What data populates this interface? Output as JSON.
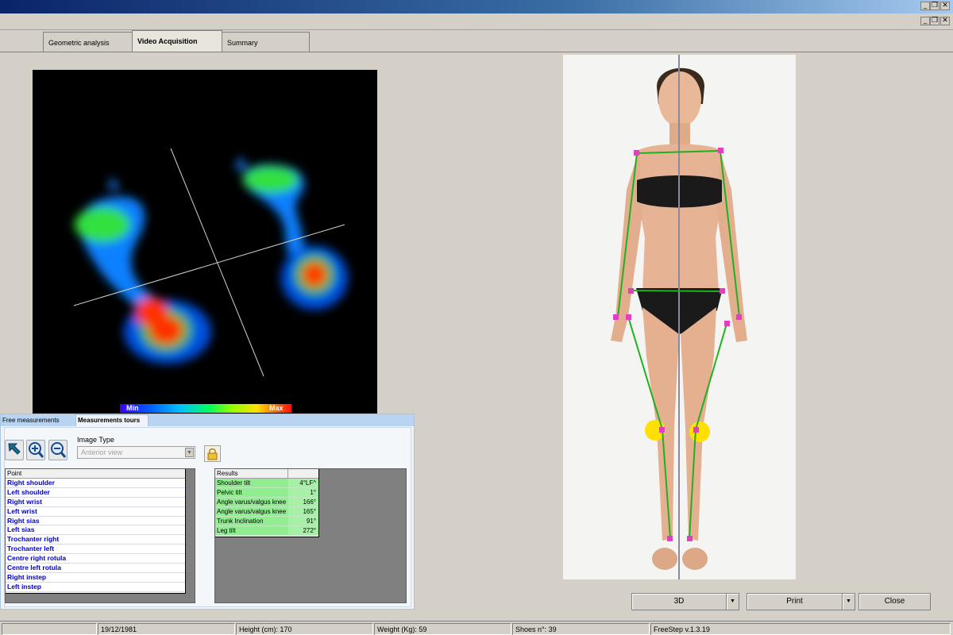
{
  "window": {
    "title": ""
  },
  "tabs": [
    {
      "label": "Geometric analysis"
    },
    {
      "label": "Video Acquisition"
    },
    {
      "label": "Summary"
    }
  ],
  "heatmap": {
    "min_label": "Min",
    "max_label": "Max"
  },
  "panel": {
    "tabs": [
      {
        "label": "Free measurements"
      },
      {
        "label": "Measurements tours"
      }
    ],
    "image_type_label": "Image Type",
    "image_type_value": "Anterior view",
    "point_header": "Point",
    "points": [
      "Right shoulder",
      "Left shoulder",
      "Right wrist",
      "Left wrist",
      "Right sias",
      "Left sias",
      "Trochanter right",
      "Trochanter left",
      "Centre right rotula",
      "Centre left rotula",
      "Right instep",
      "Left instep"
    ],
    "results_header": "Results",
    "results": [
      {
        "name": "Shoulder tilt",
        "value": "4°LF^"
      },
      {
        "name": "Pelvic tilt",
        "value": "1°"
      },
      {
        "name": "Angle varus/valgus knee",
        "value": "166°"
      },
      {
        "name": "Angle varus/valgus knee",
        "value": "165°"
      },
      {
        "name": "Trunk Inclination",
        "value": "91°"
      },
      {
        "name": "Leg tilt",
        "value": "272°"
      }
    ]
  },
  "buttons": {
    "btn_3d": "3D",
    "print": "Print",
    "close": "Close"
  },
  "status": {
    "date": "19/12/1981",
    "height": "Height (cm): 170",
    "weight": "Weight (Kg): 59",
    "shoes": "Shoes n°: 39",
    "version": "FreeStep v.1.3.19"
  },
  "colors": {
    "marker": "#e040c0",
    "skeleton": "#20b020",
    "knee": "#ffe000"
  },
  "icons": [
    "arrow-up-left-icon",
    "zoom-in-icon",
    "zoom-out-icon",
    "lock-icon",
    "minimize-icon",
    "restore-icon",
    "close-icon"
  ]
}
